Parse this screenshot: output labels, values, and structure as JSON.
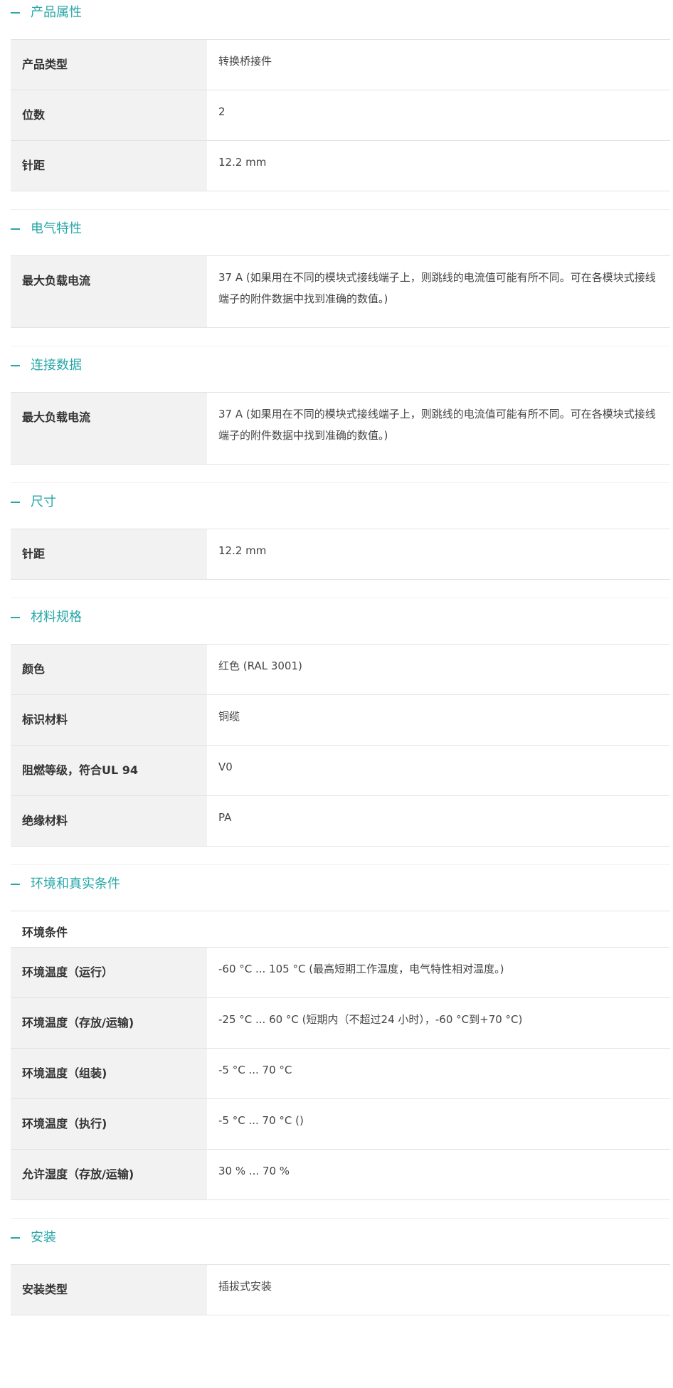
{
  "sections": [
    {
      "title": "产品属性",
      "rows": [
        {
          "label": "产品类型",
          "value": "转换桥接件"
        },
        {
          "label": "位数",
          "value": "2"
        },
        {
          "label": "针距",
          "value": "12.2 mm"
        }
      ]
    },
    {
      "title": "电气特性",
      "rows": [
        {
          "label": "最大负载电流",
          "value": "37 A (如果用在不同的模块式接线端子上，则跳线的电流值可能有所不同。可在各模块式接线端子的附件数据中找到准确的数值。)"
        }
      ]
    },
    {
      "title": "连接数据",
      "rows": [
        {
          "label": "最大负载电流",
          "value": "37 A (如果用在不同的模块式接线端子上，则跳线的电流值可能有所不同。可在各模块式接线端子的附件数据中找到准确的数值。)"
        }
      ]
    },
    {
      "title": "尺寸",
      "rows": [
        {
          "label": "针距",
          "value": "12.2 mm"
        }
      ]
    },
    {
      "title": "材料规格",
      "rows": [
        {
          "label": "颜色",
          "value": "红色 (RAL 3001)"
        },
        {
          "label": "标识材料",
          "value": "铜缆"
        },
        {
          "label": "阻燃等级，符合UL 94",
          "value": "V0"
        },
        {
          "label": "绝缘材料",
          "value": "PA"
        }
      ]
    },
    {
      "title": "环境和真实条件",
      "subheading": "环境条件",
      "rows": [
        {
          "label": "环境温度（运行）",
          "value": "-60 °C ... 105 °C (最高短期工作温度，电气特性相对温度。)"
        },
        {
          "label": "环境温度（存放/运输)",
          "value": "-25 °C ... 60 °C (短期内（不超过24  小时），-60 °C到+70 °C)"
        },
        {
          "label": "环境温度（组装)",
          "value": "-5 °C ... 70 °C"
        },
        {
          "label": "环境温度（执行)",
          "value": "-5 °C ... 70 °C ()"
        },
        {
          "label": "允许湿度（存放/运输)",
          "value": "30 % ... 70 %"
        }
      ]
    },
    {
      "title": "安装",
      "rows": [
        {
          "label": "安装类型",
          "value": "插拔式安装"
        }
      ]
    }
  ],
  "colors": {
    "accent": "#28a7a8",
    "label_bg": "#f2f2f2",
    "border": "#e3e3e3"
  },
  "icons": {
    "section_toggle": "minus-icon"
  }
}
